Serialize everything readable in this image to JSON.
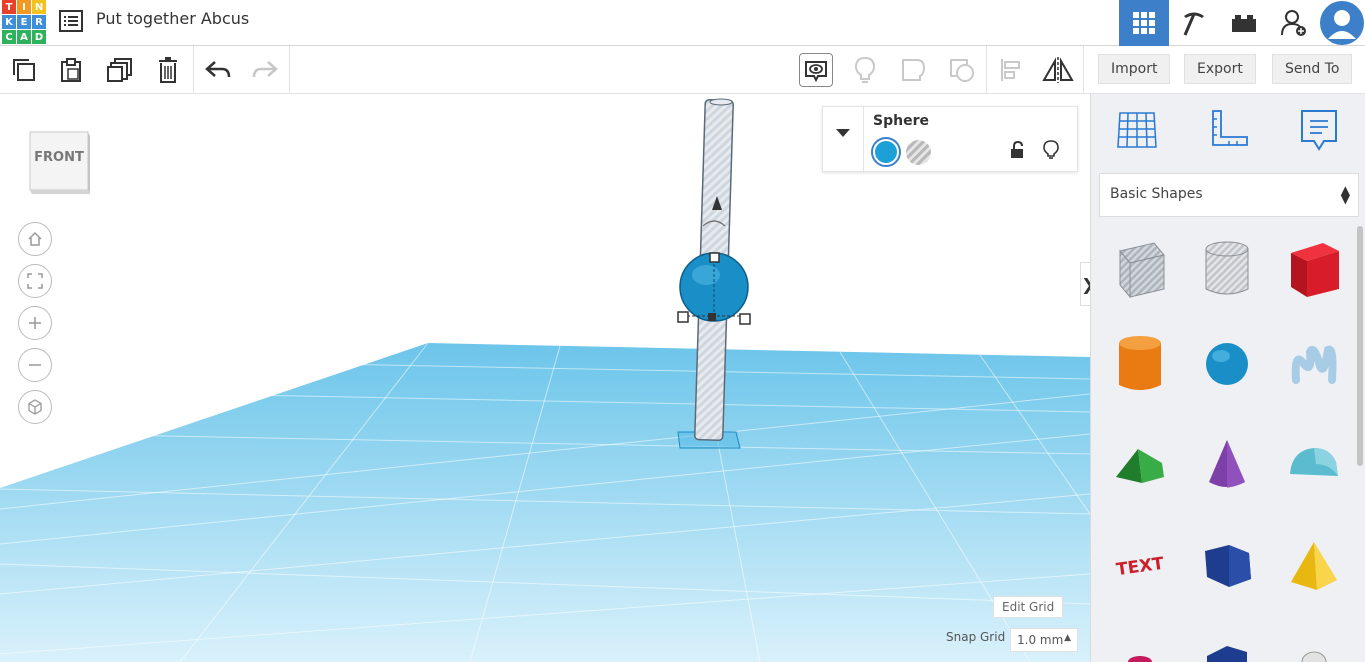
{
  "app": {
    "logo_letters": [
      "T",
      "I",
      "N",
      "K",
      "E",
      "R",
      "C",
      "A",
      "D"
    ],
    "logo_colors": [
      "#e8412b",
      "#f29a1f",
      "#f2c21f",
      "#3f8ed8",
      "#3f8ed8",
      "#3f8ed8",
      "#2fb25d",
      "#2fb25d",
      "#2fb25d"
    ],
    "design_title": "Put together Abcus"
  },
  "topbar": {
    "icons": [
      "grid-view-icon",
      "pickaxe-icon",
      "bricks-icon",
      "add-user-icon",
      "user-avatar-icon"
    ],
    "active_color": "#3d80c9"
  },
  "toolbar": {
    "left_icons": [
      "copy-icon",
      "paste-icon",
      "duplicate-icon",
      "delete-icon",
      "undo-icon",
      "redo-icon"
    ],
    "right_icons": [
      "show-notes-icon",
      "light-icon",
      "group-icon",
      "hole-icon",
      "align-icon",
      "mirror-icon"
    ],
    "import_label": "Import",
    "export_label": "Export",
    "send_to_label": "Send To"
  },
  "viewport": {
    "view_cube_label": "FRONT",
    "nav_buttons": [
      "home-view-icon",
      "fit-all-icon",
      "zoom-in-icon",
      "zoom-out-icon",
      "perspective-icon"
    ],
    "edit_grid_label": "Edit Grid",
    "snap_grid_label": "Snap Grid",
    "snap_grid_value": "1.0 mm",
    "workplane_color": "#8fd3ee",
    "selection_color": "#1aa3cf"
  },
  "inspector": {
    "shape_name": "Sphere",
    "solid_color": "#1ca0d8",
    "hole_label": "hole"
  },
  "panel": {
    "tabs": [
      "workplane-icon",
      "ruler-icon",
      "notes-icon"
    ],
    "category": "Basic Shapes",
    "shapes": [
      "Box",
      "Cylinder Hole",
      "Box",
      "Cylinder",
      "Sphere",
      "Scribble",
      "Roof",
      "Cone",
      "Round Roof",
      "Text",
      "Polygon",
      "Pyramid"
    ],
    "shape_colors": [
      "#b8bcc4",
      "#cfd2d6",
      "#e01b2c",
      "#ee7d16",
      "#1b8ec4",
      "#a8c9e3",
      "#2f9e3c",
      "#7b3fa6",
      "#63bfd1",
      "#cc1f2b",
      "#1f3d8f",
      "#f4c81c"
    ]
  }
}
